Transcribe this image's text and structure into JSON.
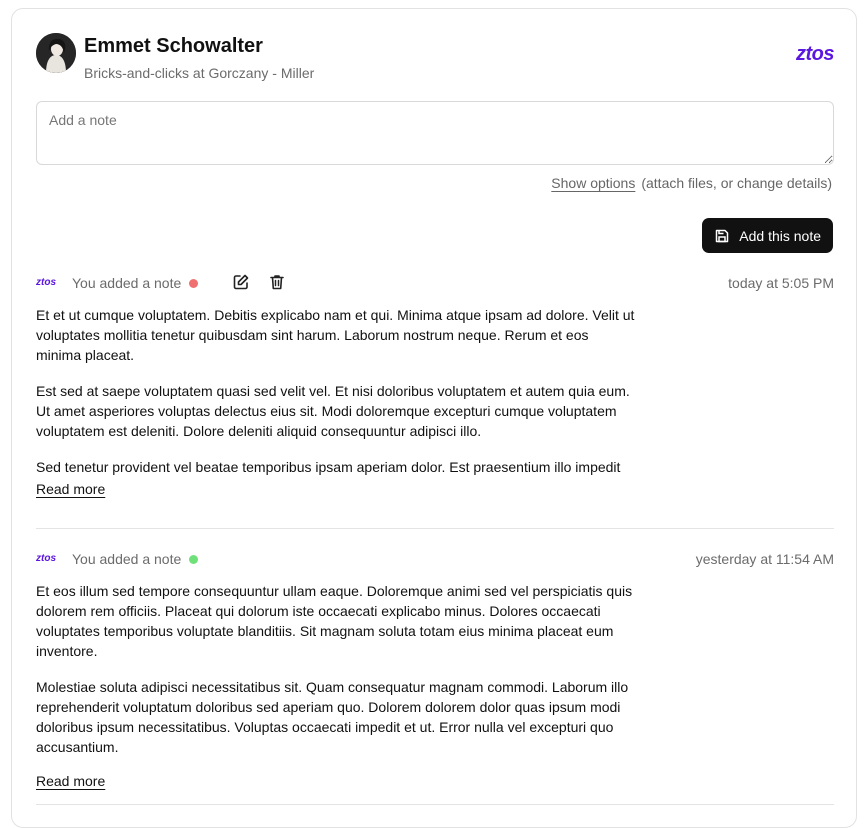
{
  "contact": {
    "name": "Emmet Schowalter",
    "company": "Bricks-and-clicks at Gorczany - Miller"
  },
  "brand": {
    "logo_text": "ztos",
    "color": "#5b16e0"
  },
  "composer": {
    "placeholder": "Add a note",
    "show_options_label": "Show options",
    "options_hint": "(attach files, or change details)",
    "submit_label": "Add this note"
  },
  "notes": [
    {
      "logo": "ztos",
      "author": "You added a note",
      "status_color": "#f07070",
      "time": "today at 5:05 PM",
      "paragraphs": [
        "Et et ut cumque voluptatem. Debitis explicabo nam et qui. Minima atque ipsam ad dolore. Velit ut voluptates mollitia tenetur quibusdam sint harum. Laborum nostrum neque. Rerum et eos minima placeat.",
        "Est sed at saepe voluptatem quasi sed velit vel. Et nisi doloribus voluptatem et autem quia eum. Ut amet asperiores voluptas delectus eius sit. Modi doloremque excepturi cumque voluptatem voluptatem est deleniti. Dolore deleniti aliquid consequuntur adipisci illo.",
        "Sed tenetur provident vel beatae temporibus ipsam aperiam dolor. Est praesentium illo impedit ipsa. Qui quo itaque illum et labore. Nesciunt est hic quia consectetur vel vel quia. Sed sunt"
      ],
      "read_more": "Read more"
    },
    {
      "logo": "ztos",
      "author": "You added a note",
      "status_color": "#6fe07a",
      "time": "yesterday at 11:54 AM",
      "paragraphs": [
        "Et eos illum sed tempore consequuntur ullam eaque. Doloremque animi sed vel perspiciatis quis dolorem rem officiis. Placeat qui dolorum iste occaecati explicabo minus. Dolores occaecati voluptates temporibus voluptate blanditiis. Sit magnam soluta totam eius minima placeat eum inventore.",
        "Molestiae soluta adipisci necessitatibus sit. Quam consequatur magnam commodi. Laborum illo reprehenderit voluptatum doloribus sed aperiam quo. Dolorem dolorem dolor quas ipsum modi doloribus ipsum necessitatibus. Voluptas occaecati impedit et ut. Error nulla vel excepturi quo accusantium."
      ],
      "read_more": "Read more"
    }
  ]
}
